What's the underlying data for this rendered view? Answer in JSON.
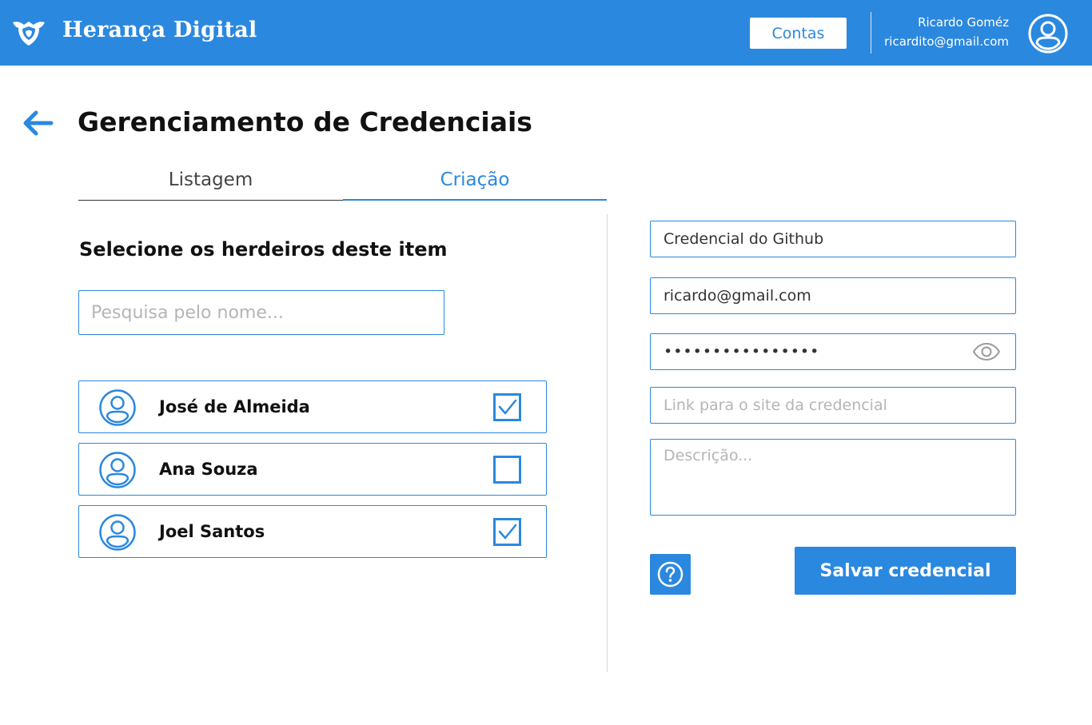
{
  "header": {
    "brand": "Herança Digital",
    "accounts_button": "Contas",
    "user_name": "Ricardo Goméz",
    "user_email": "ricardito@gmail.com"
  },
  "page": {
    "title": "Gerenciamento de Credenciais"
  },
  "tabs": [
    {
      "label": "Listagem",
      "active": false
    },
    {
      "label": "Criação",
      "active": true
    }
  ],
  "heirs": {
    "section_title": "Selecione os herdeiros deste item",
    "search_placeholder": "Pesquisa pelo nome...",
    "items": [
      {
        "name": "José de Almeida",
        "checked": true
      },
      {
        "name": "Ana Souza",
        "checked": false
      },
      {
        "name": "Joel Santos",
        "checked": true
      }
    ]
  },
  "form": {
    "title_value": "Credencial do Github",
    "login_value": "ricardo@gmail.com",
    "password_value": "••••••••••••••••",
    "link_placeholder": "Link para o site da credencial",
    "description_placeholder": "Descrição...",
    "save_button": "Salvar credencial"
  },
  "colors": {
    "primary": "#2b88df",
    "header_bg": "#2b88df",
    "text": "#111111"
  },
  "icons": {
    "logo": "shield-wings-icon",
    "user": "user-circle-icon",
    "back": "arrow-left-icon",
    "checkbox_checked": "checkbox-checked-icon",
    "checkbox_empty": "checkbox-empty-icon",
    "eye": "eye-icon",
    "help": "question-circle-icon"
  }
}
